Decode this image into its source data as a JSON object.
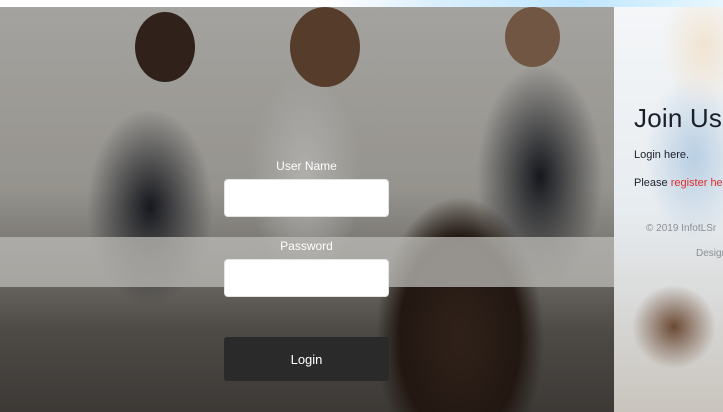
{
  "form": {
    "username_label": "User Name",
    "username_value": "",
    "password_label": "Password",
    "password_value": "",
    "login_button": "Login"
  },
  "panel": {
    "title": "Join Us",
    "login_here": "Login here.",
    "register_prefix": "Please ",
    "register_link": "register here",
    "copyright": "© 2019 InfotLSr",
    "designed": "Designed"
  },
  "colors": {
    "link": "#e12b2b",
    "button_bg": "#2a2a2a"
  }
}
